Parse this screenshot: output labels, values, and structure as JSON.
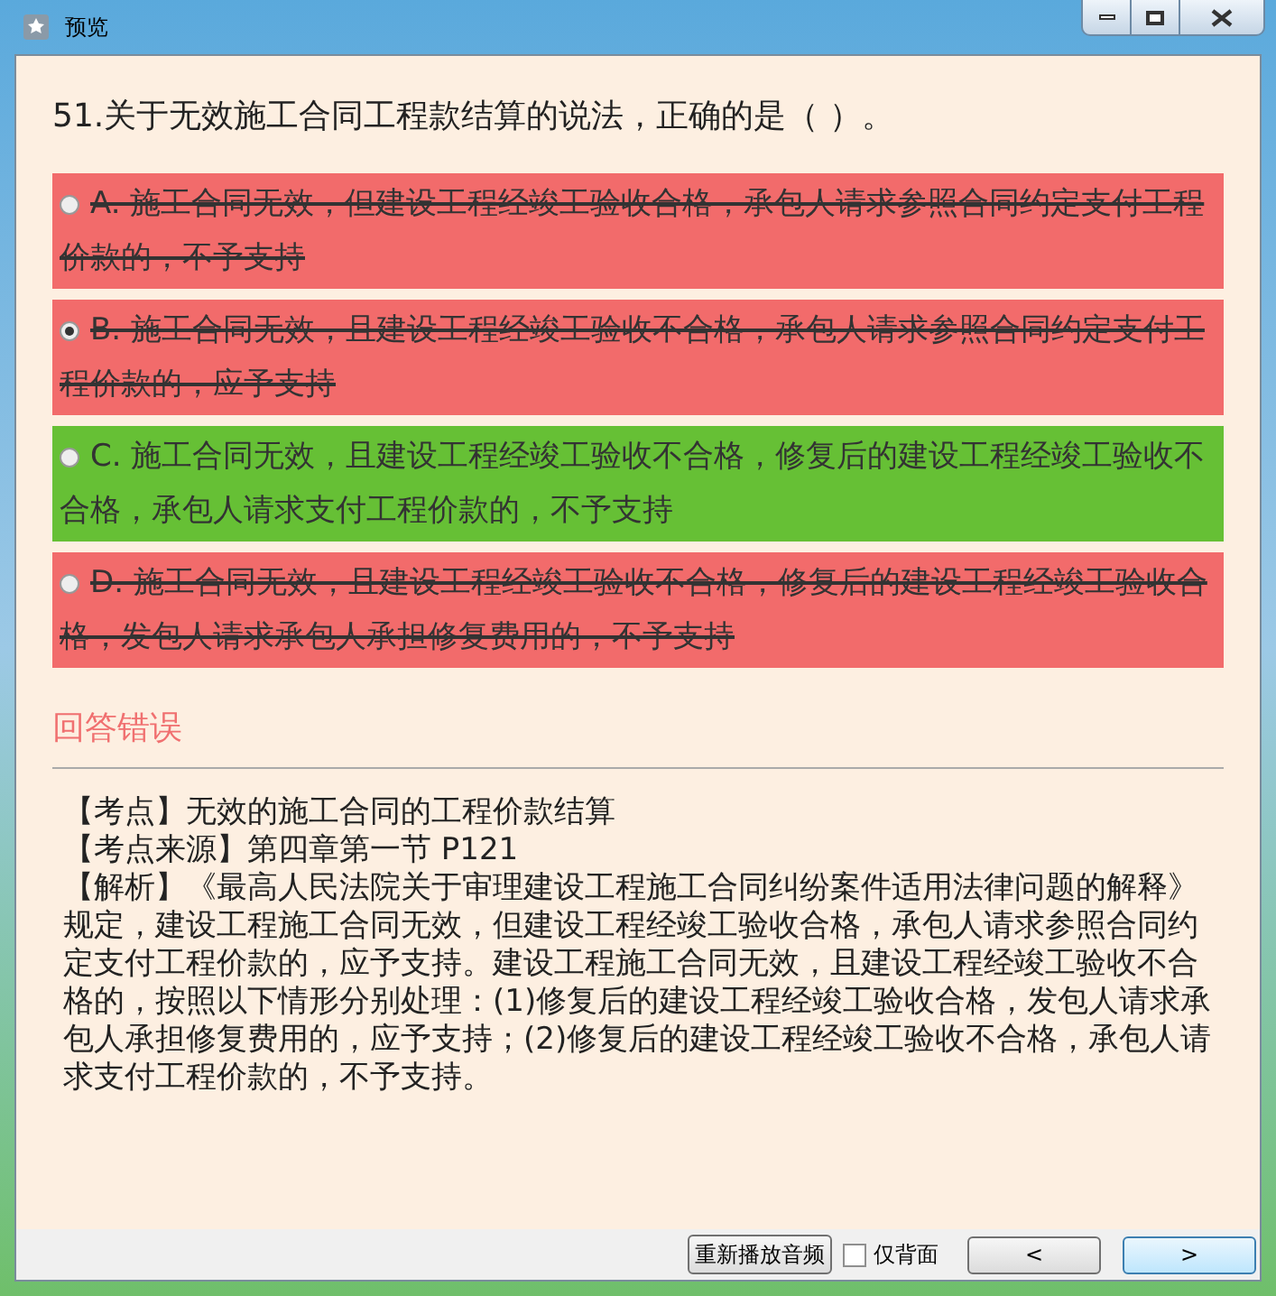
{
  "window": {
    "title": "预览"
  },
  "question": "51.关于无效施工合同工程款结算的说法，正确的是（ ）。",
  "options": [
    {
      "text": "A. 施工合同无效，但建设工程经竣工验收合格，承包人请求参照合同约定支付工程价款的，不予支持",
      "kind": "wrong",
      "selected": false
    },
    {
      "text": "B. 施工合同无效，且建设工程经竣工验收不合格，承包人请求参照合同约定支付工程价款的，应予支持",
      "kind": "wrong",
      "selected": true
    },
    {
      "text": "C. 施工合同无效，且建设工程经竣工验收不合格，修复后的建设工程经竣工验收不合格，承包人请求支付工程价款的，不予支持",
      "kind": "correct",
      "selected": false
    },
    {
      "text": "D. 施工合同无效，且建设工程经竣工验收不合格，修复后的建设工程经竣工验收合格，发包人请求承包人承担修复费用的，不予支持",
      "kind": "wrong",
      "selected": false
    }
  ],
  "result": "回答错误",
  "explanation": [
    "【考点】无效的施工合同的工程价款结算",
    "【考点来源】第四章第一节 P121",
    "【解析】《最高人民法院关于审理建设工程施工合同纠纷案件适用法律问题的解释》规定，建设工程施工合同无效，但建设工程经竣工验收合格，承包人请求参照合同约定支付工程价款的，应予支持。建设工程施工合同无效，且建设工程经竣工验收不合格的，按照以下情形分别处理：(1)修复后的建设工程经竣工验收合格，发包人请求承包人承担修复费用的，应予支持；(2)修复后的建设工程经竣工验收不合格，承包人请求支付工程价款的，不予支持。"
  ],
  "footer": {
    "replay_button": "重新播放音频",
    "back_only": {
      "label": "仅背面",
      "checked": false
    },
    "prev_button": "<",
    "next_button": ">"
  }
}
